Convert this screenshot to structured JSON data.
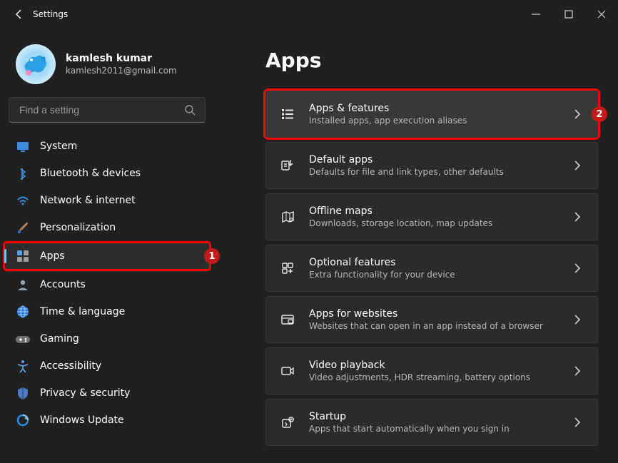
{
  "window": {
    "title": "Settings"
  },
  "user": {
    "name": "kamlesh kumar",
    "email": "kamlesh2011@gmail.com"
  },
  "search": {
    "placeholder": "Find a setting"
  },
  "sidebar": {
    "items": [
      {
        "icon": "display-icon",
        "label": "System"
      },
      {
        "icon": "bluetooth-icon",
        "label": "Bluetooth & devices"
      },
      {
        "icon": "wifi-icon",
        "label": "Network & internet"
      },
      {
        "icon": "brush-icon",
        "label": "Personalization"
      },
      {
        "icon": "apps-icon",
        "label": "Apps",
        "selected": true,
        "highlight": true,
        "badge": "1"
      },
      {
        "icon": "account-icon",
        "label": "Accounts"
      },
      {
        "icon": "globe-icon",
        "label": "Time & language"
      },
      {
        "icon": "game-icon",
        "label": "Gaming"
      },
      {
        "icon": "access-icon",
        "label": "Accessibility"
      },
      {
        "icon": "shield-icon",
        "label": "Privacy & security"
      },
      {
        "icon": "update-icon",
        "label": "Windows Update"
      }
    ]
  },
  "page": {
    "title": "Apps"
  },
  "cards": [
    {
      "icon": "list-icon",
      "title": "Apps & features",
      "sub": "Installed apps, app execution aliases",
      "highlight": true,
      "badge": "2"
    },
    {
      "icon": "defaults-icon",
      "title": "Default apps",
      "sub": "Defaults for file and link types, other defaults"
    },
    {
      "icon": "map-icon",
      "title": "Offline maps",
      "sub": "Downloads, storage location, map updates"
    },
    {
      "icon": "optional-icon",
      "title": "Optional features",
      "sub": "Extra functionality for your device"
    },
    {
      "icon": "webapps-icon",
      "title": "Apps for websites",
      "sub": "Websites that can open in an app instead of a browser"
    },
    {
      "icon": "video-icon",
      "title": "Video playback",
      "sub": "Video adjustments, HDR streaming, battery options"
    },
    {
      "icon": "startup-icon",
      "title": "Startup",
      "sub": "Apps that start automatically when you sign in"
    }
  ]
}
